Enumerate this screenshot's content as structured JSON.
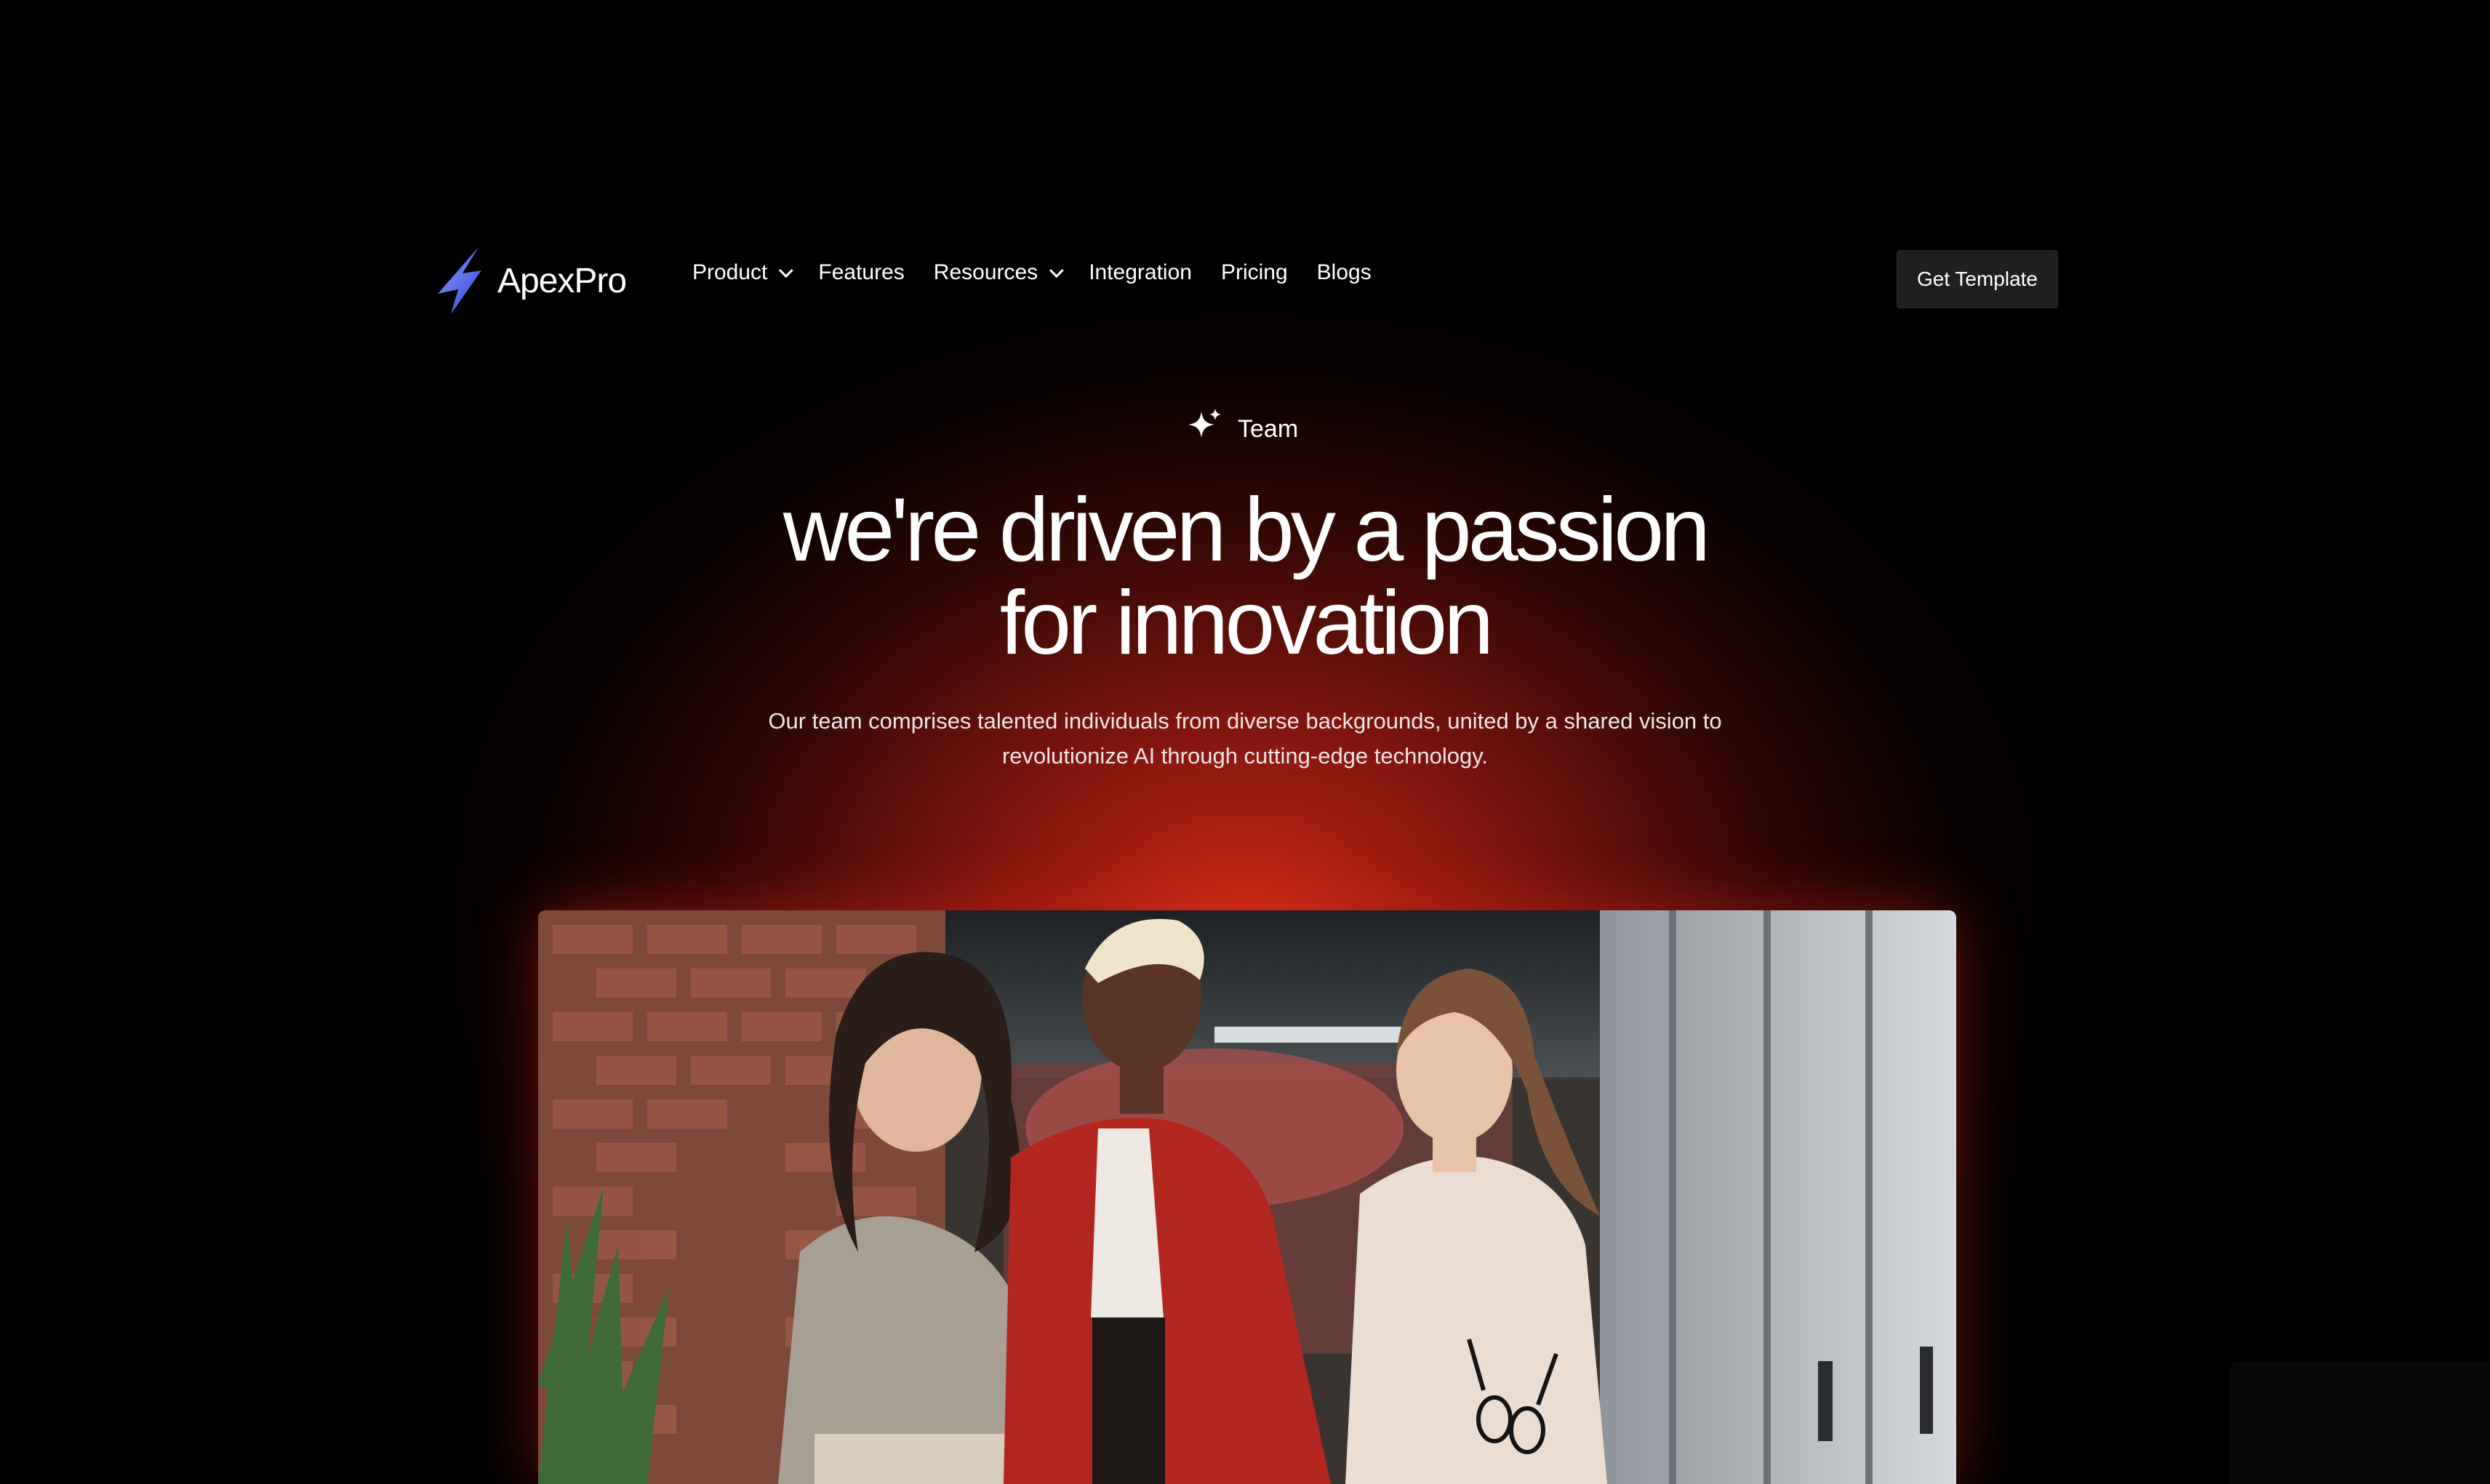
{
  "brand": {
    "name": "ApexPro",
    "logo_icon": "lightning-bolt-icon"
  },
  "nav": {
    "items": [
      {
        "label": "Product",
        "dropdown": true
      },
      {
        "label": "Features",
        "dropdown": false
      },
      {
        "label": "Resources",
        "dropdown": true
      },
      {
        "label": "Integration",
        "dropdown": false
      },
      {
        "label": "Pricing",
        "dropdown": false
      },
      {
        "label": "Blogs",
        "dropdown": false
      }
    ],
    "cta_label": "Get Template"
  },
  "hero": {
    "badge_label": "Team",
    "badge_icon": "sparkle-icon",
    "headline_line1": "we're driven by a passion",
    "headline_line2": "for innovation",
    "subtext_line1": "Our team comprises talented individuals from diverse backgrounds, united by a shared vision to",
    "subtext_line2": "revolutionize AI through cutting-edge technology."
  },
  "colors": {
    "background": "#000000",
    "glow": "#d62c18",
    "logo_gradient_start": "#7b8cff",
    "logo_gradient_end": "#3b4bdb",
    "button_bg": "#1f1f1f"
  }
}
